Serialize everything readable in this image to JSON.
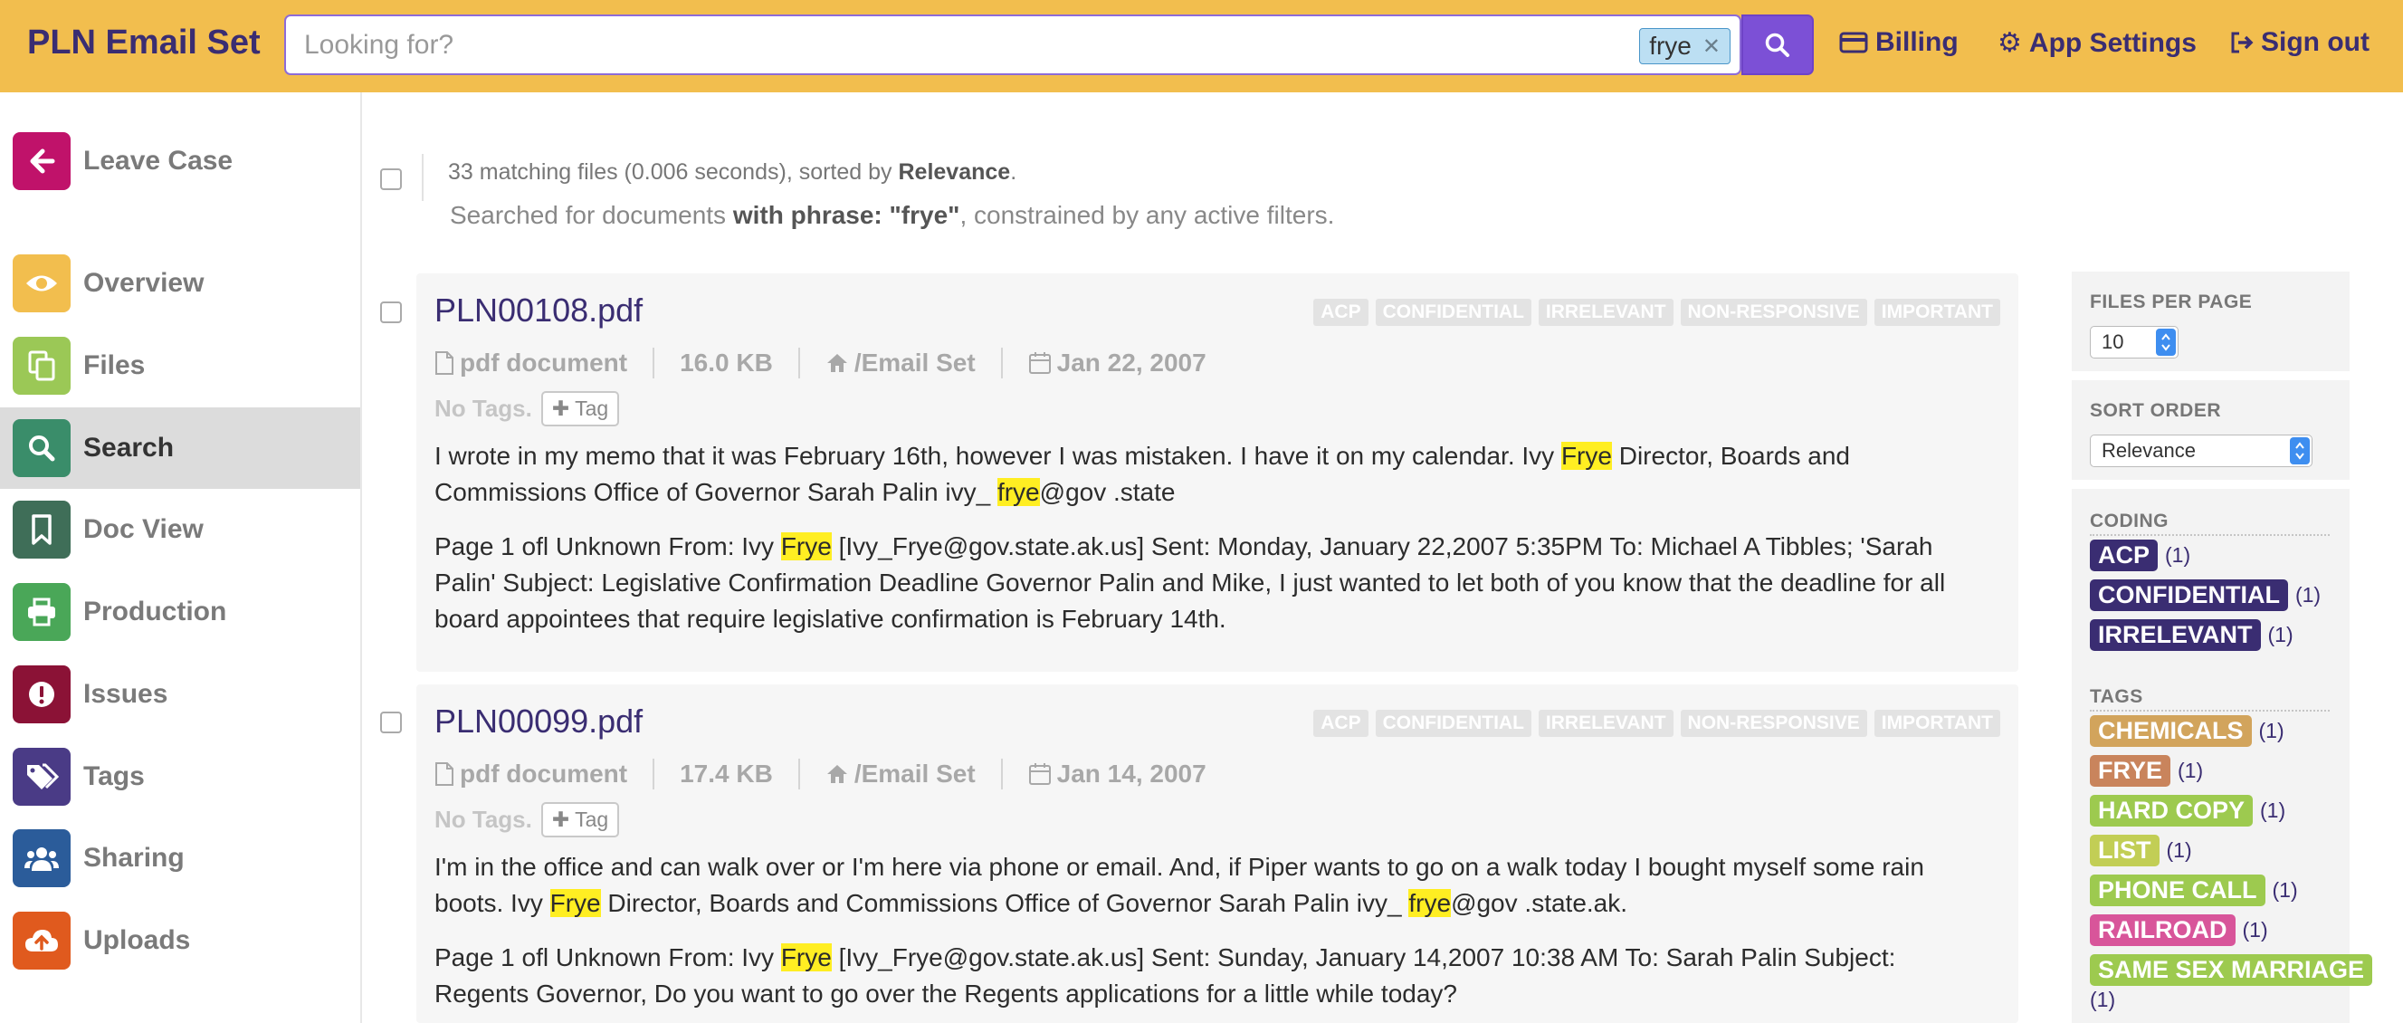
{
  "app": {
    "title": "PLN Email Set"
  },
  "search": {
    "placeholder": "Looking for?",
    "value": "",
    "chip": "frye"
  },
  "nav": {
    "billing": "Billing",
    "settings": "App Settings",
    "signout": "Sign out"
  },
  "sidebar": {
    "items": [
      {
        "label": "Leave Case",
        "icon": "arrow-left-icon",
        "color": "#c0126a"
      },
      {
        "label": "Overview",
        "icon": "eye-icon",
        "color": "#f2be4e"
      },
      {
        "label": "Files",
        "icon": "files-icon",
        "color": "#9bc856"
      },
      {
        "label": "Search",
        "icon": "search-icon",
        "color": "#3a8d6a",
        "active": true
      },
      {
        "label": "Doc View",
        "icon": "bookmark-icon",
        "color": "#3f6e58"
      },
      {
        "label": "Production",
        "icon": "print-icon",
        "color": "#4aa758"
      },
      {
        "label": "Issues",
        "icon": "exclamation-icon",
        "color": "#8b1236"
      },
      {
        "label": "Tags",
        "icon": "tags-icon",
        "color": "#4a3b86"
      },
      {
        "label": "Sharing",
        "icon": "users-icon",
        "color": "#2b5c9a"
      },
      {
        "label": "Uploads",
        "icon": "cloud-upload-icon",
        "color": "#e05a1e"
      }
    ]
  },
  "results": {
    "meta_prefix": "33 matching files (0.006 seconds), sorted by ",
    "meta_sort": "Relevance",
    "meta_suffix": ".",
    "query_prefix": "Searched for documents ",
    "query_bold": "with phrase: \"frye\"",
    "query_suffix": ", constrained by any active filters.",
    "items": [
      {
        "title": "PLN00108.pdf",
        "badges": [
          "ACP",
          "CONFIDENTIAL",
          "IRRELEVANT",
          "NON-RESPONSIVE",
          "IMPORTANT"
        ],
        "doctype": "pdf document",
        "size": "16.0 KB",
        "path": "/Email Set",
        "date": "Jan 22, 2007",
        "no_tags": "No Tags.",
        "tag_button": "Tag",
        "snippet1": [
          "I wrote in my memo that it was February 16th, however I was mistaken. I have it on my calendar. Ivy ",
          "Frye",
          " Director, Boards and Commissions Office of Governor Sarah Palin ivy_ ",
          "frye",
          "@gov .state"
        ],
        "snippet2": [
          "Page 1 ofl Unknown From: Ivy ",
          "Frye",
          " [Ivy_Frye@gov.state.ak.us] Sent: Monday, January 22,2007 5:35PM To: Michael A Tibbles; 'Sarah Palin' Subject: Legislative Confirmation Deadline Governor Palin and Mike, I just wanted to let both of you know that the deadline for all board appointees that require legislative confirmation is February 14th."
        ]
      },
      {
        "title": "PLN00099.pdf",
        "badges": [
          "ACP",
          "CONFIDENTIAL",
          "IRRELEVANT",
          "NON-RESPONSIVE",
          "IMPORTANT"
        ],
        "doctype": "pdf document",
        "size": "17.4 KB",
        "path": "/Email Set",
        "date": "Jan 14, 2007",
        "no_tags": "No Tags.",
        "tag_button": "Tag",
        "snippet1": [
          "I'm in the office and can walk over or I'm here via phone or email. And, if Piper wants to go on a walk today I bought myself some rain boots. Ivy ",
          "Frye",
          " Director, Boards and Commissions Office of Governor Sarah Palin ivy_ ",
          "frye",
          "@gov .state.ak."
        ],
        "snippet2": [
          "Page 1 ofl Unknown From: Ivy ",
          "Frye",
          " [Ivy_Frye@gov.state.ak.us] Sent: Sunday, January 14,2007 10:38 AM To: Sarah Palin Subject: Regents Governor, Do you want to go over the Regents applications for a little while today?"
        ]
      }
    ]
  },
  "filters": {
    "files_per_page_label": "FILES PER PAGE",
    "files_per_page": "10",
    "sort_order_label": "SORT ORDER",
    "sort_order": "Relevance",
    "coding_label": "CODING",
    "coding": [
      {
        "label": "ACP",
        "count": "(1)"
      },
      {
        "label": "CONFIDENTIAL",
        "count": "(1)"
      },
      {
        "label": "IRRELEVANT",
        "count": "(1)"
      }
    ],
    "tags_label": "TAGS",
    "tags": [
      {
        "label": "CHEMICALS",
        "count": "(1)",
        "color": "#d2a45c"
      },
      {
        "label": "FRYE",
        "count": "(1)",
        "color": "#c9845c"
      },
      {
        "label": "HARD COPY",
        "count": "(1)",
        "color": "#9dca4f"
      },
      {
        "label": "LIST",
        "count": "(1)",
        "color": "#c2ce55"
      },
      {
        "label": "PHONE CALL",
        "count": "(1)",
        "color": "#9dca4f"
      },
      {
        "label": "RAILROAD",
        "count": "(1)",
        "color": "#d8559a"
      },
      {
        "label": "SAME SEX MARRIAGE",
        "count": "(1)",
        "color": "#9dca4f"
      }
    ]
  }
}
